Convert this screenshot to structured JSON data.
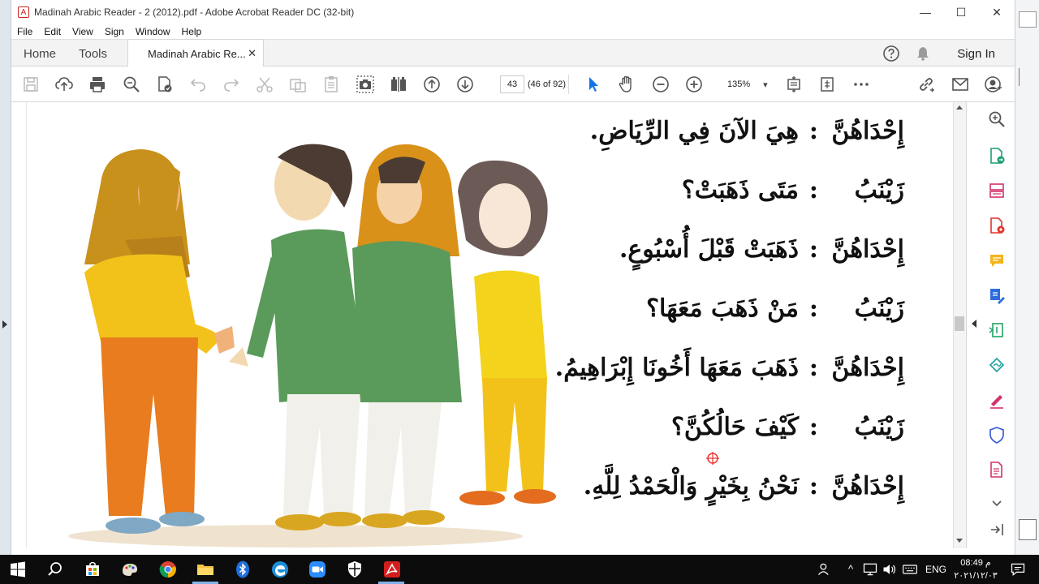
{
  "window": {
    "title": "Madinah Arabic Reader - 2 (2012).pdf - Adobe Acrobat Reader DC (32-bit)",
    "minimize_glyph": "—",
    "maximize_glyph": "☐",
    "close_glyph": "✕"
  },
  "menu": [
    "File",
    "Edit",
    "View",
    "Sign",
    "Window",
    "Help"
  ],
  "tabs": {
    "home": "Home",
    "tools": "Tools",
    "document": "Madinah Arabic Re...",
    "close_glyph": "✕",
    "sign_in": "Sign In"
  },
  "toolbar": {
    "page_number": "43",
    "page_count": "(46 of 92)",
    "zoom": "135%",
    "zoom_caret": "▾"
  },
  "document": {
    "lines": [
      {
        "speaker": "إِحْدَاهُنَّ",
        "colon": ":",
        "text": "هِيَ الآنَ فِي الرِّيَاضِ."
      },
      {
        "speaker": "زَيْنَبُ",
        "colon": ":",
        "text": "مَتَى ذَهَبَتْ؟"
      },
      {
        "speaker": "إِحْدَاهُنَّ",
        "colon": ":",
        "text": "ذَهَبَتْ قَبْلَ أُسْبُوعٍ."
      },
      {
        "speaker": "زَيْنَبُ",
        "colon": ":",
        "text": "مَنْ ذَهَبَ مَعَهَا؟"
      },
      {
        "speaker": "إِحْدَاهُنَّ",
        "colon": ":",
        "text": "ذَهَبَ مَعَهَا أَخُونَا إِبْرَاهِيمُ."
      },
      {
        "speaker": "زَيْنَبُ",
        "colon": ":",
        "text": "كَيْفَ حَالُكُنَّ؟"
      },
      {
        "speaker": "إِحْدَاهُنَّ",
        "colon": ":",
        "text": "نَحْنُ بِخَيْرٍ وَالْحَمْدُ لِلَّهِ."
      }
    ]
  },
  "taskbar": {
    "language": "ENG",
    "time": "08:49 م",
    "date": "٢٠٢١/١٢/٠٣"
  },
  "colors": {
    "acrobat_red": "#d41e1e",
    "taskbar": "#0c0c0d",
    "selection_blue": "#1473e6"
  },
  "icons": {
    "toolbar": [
      "save-icon",
      "upload-icon",
      "print-icon",
      "find-icon",
      "protect-icon",
      "undo-icon",
      "redo-icon",
      "cut-icon",
      "copy-icon",
      "paste-icon",
      "snapshot-icon",
      "compare-icon",
      "previous-page-icon",
      "next-page-icon",
      "select-cursor-icon",
      "hand-icon",
      "zoom-out-icon",
      "zoom-in-icon",
      "fit-page-icon",
      "scroll-mode-icon",
      "more-icon",
      "link-icon",
      "email-icon",
      "account-icon"
    ],
    "side_panel": [
      "search-zoom-icon",
      "export-pdf-icon",
      "organize-pages-icon",
      "create-pdf-icon",
      "comment-icon",
      "edit-pdf-icon",
      "compress-icon",
      "send-for-signature-icon",
      "fill-sign-icon",
      "protect-shield-icon",
      "more-tools-icon",
      "expand-icon",
      "collapse-panel-icon"
    ]
  }
}
